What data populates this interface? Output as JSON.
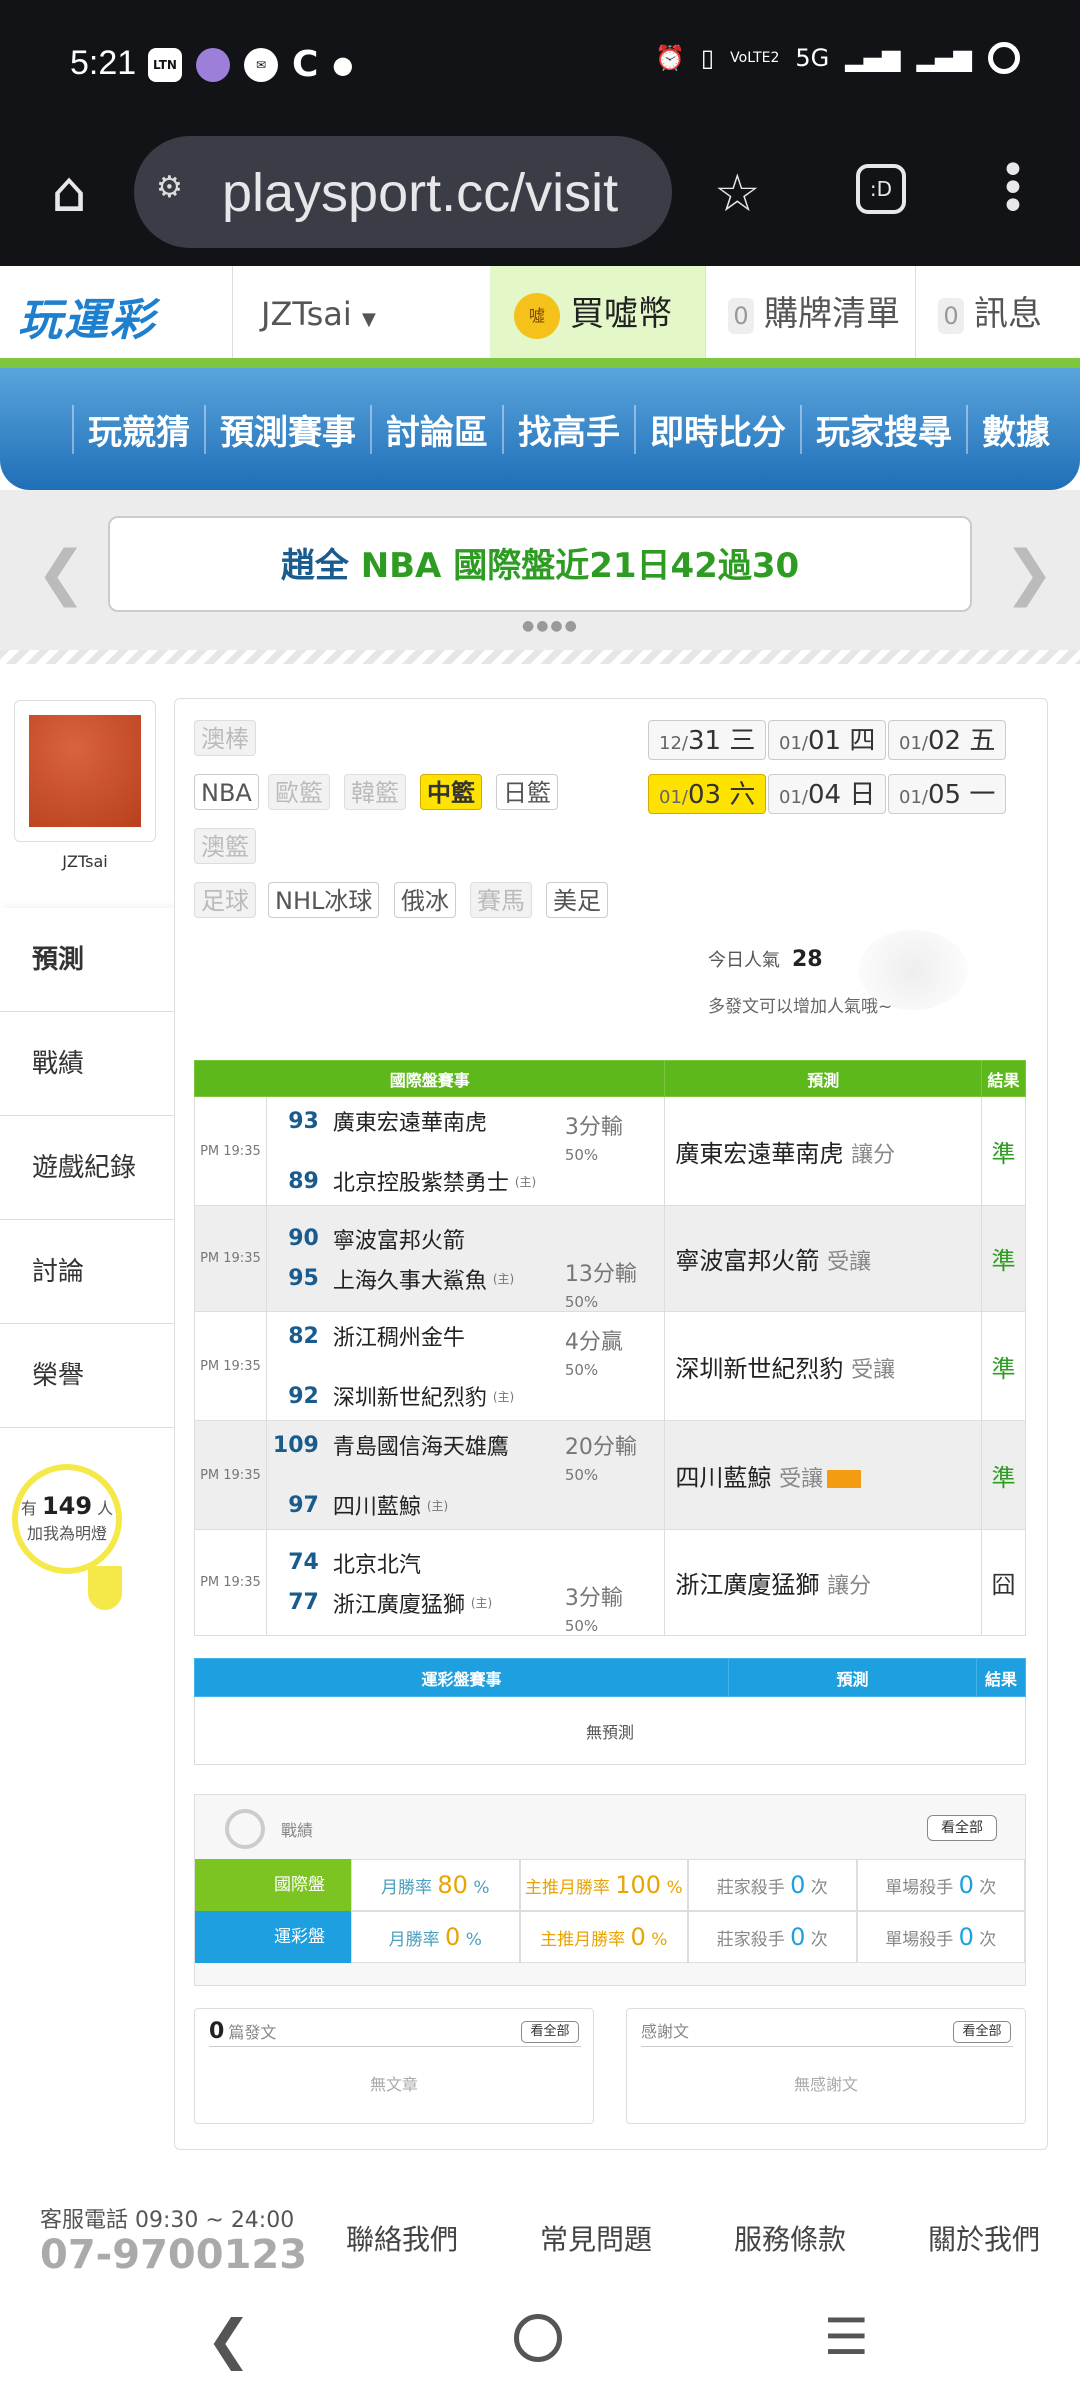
{
  "status": {
    "time": "5:21",
    "icons": [
      "LTN",
      "Twitter",
      "Messenger",
      "C"
    ],
    "network": "5G"
  },
  "browser": {
    "url": "playsport.cc/visit"
  },
  "header": {
    "logo": "玩運彩",
    "username": "JZTsai",
    "coin": "買噓幣",
    "cart_count": "0",
    "cart_label": "購牌清單",
    "msg_count": "0",
    "msg_label": "訊息"
  },
  "nav": [
    "玩競猜",
    "預測賽事",
    "討論區",
    "找高手",
    "即時比分",
    "玩家搜尋",
    "數據"
  ],
  "banner": {
    "part1": "趙全",
    "part2": "NBA 國際盤近21日42過30"
  },
  "user": {
    "name": "JZTsai"
  },
  "left_menu": [
    "預測",
    "戰績",
    "遊戲紀錄",
    "討論",
    "榮譽"
  ],
  "bulb": {
    "prefix": "有",
    "count": "149",
    "suffix": "人",
    "line2": "加我為明燈"
  },
  "sports": {
    "row1": [
      "澳棒"
    ],
    "row2": [
      "NBA",
      "歐籃",
      "韓籃",
      "中籃",
      "日籃"
    ],
    "row3": [
      "澳籃"
    ],
    "row4": [
      "足球",
      "NHL冰球",
      "俄冰",
      "賽馬",
      "美足"
    ]
  },
  "dates": [
    {
      "md": "12/",
      "d": "31",
      "w": "三"
    },
    {
      "md": "01/",
      "d": "01",
      "w": "四"
    },
    {
      "md": "01/",
      "d": "02",
      "w": "五"
    },
    {
      "md": "01/",
      "d": "03",
      "w": "六"
    },
    {
      "md": "01/",
      "d": "04",
      "w": "日"
    },
    {
      "md": "01/",
      "d": "05",
      "w": "一"
    }
  ],
  "popularity": {
    "label": "今日人氣",
    "value": "28",
    "hint": "多發文可以增加人氣哦~"
  },
  "intl_table": {
    "headers": [
      "國際盤賽事",
      "預測",
      "結果"
    ],
    "rows": [
      {
        "time": "PM 19:35",
        "s1": "93",
        "t1": "廣東宏遠華南虎",
        "s2": "89",
        "t2": "北京控股紫禁勇士",
        "home": "(主)",
        "hcp": "3分輸",
        "pct": "50%",
        "pred": "廣東宏遠華南虎",
        "pred_sub": "讓分",
        "res": "準"
      },
      {
        "time": "PM 19:35",
        "s1": "90",
        "t1": "寧波富邦火箭",
        "s2": "95",
        "t2": "上海久事大鯊魚",
        "home": "(主)",
        "hcp": "13分輸",
        "pct": "50%",
        "pred": "寧波富邦火箭",
        "pred_sub": "受讓",
        "res": "準"
      },
      {
        "time": "PM 19:35",
        "s1": "82",
        "t1": "浙江稠州金牛",
        "s2": "92",
        "t2": "深圳新世紀烈豹",
        "home": "(主)",
        "hcp": "4分贏",
        "pct": "50%",
        "pred": "深圳新世紀烈豹",
        "pred_sub": "受讓",
        "res": "準"
      },
      {
        "time": "PM 19:35",
        "s1": "109",
        "t1": "青島國信海天雄鷹",
        "s2": "97",
        "t2": "四川藍鯨",
        "home": "(主)",
        "hcp": "20分輸",
        "pct": "50%",
        "pred": "四川藍鯨",
        "pred_sub": "受讓",
        "res": "準"
      },
      {
        "time": "PM 19:35",
        "s1": "74",
        "t1": "北京北汽",
        "s2": "77",
        "t2": "浙江廣廈猛獅",
        "home": "(主)",
        "hcp": "3分輸",
        "pct": "50%",
        "pred": "浙江廣廈猛獅",
        "pred_sub": "讓分",
        "res": "囧"
      }
    ]
  },
  "lottery_table": {
    "headers": [
      "運彩盤賽事",
      "預測",
      "結果"
    ],
    "empty": "無預測"
  },
  "stats": {
    "title": "戰績",
    "view_all": "看全部",
    "rows": [
      {
        "label": "國際盤",
        "color": "#7cc422",
        "c1l": "月勝率",
        "c1v": "80",
        "c2l": "主推月勝率",
        "c2v": "100",
        "c3l": "莊家殺手",
        "c3v": "0",
        "c4l": "單場殺手",
        "c4v": "0"
      },
      {
        "label": "運彩盤",
        "color": "#1ea0e0",
        "c1l": "月勝率",
        "c1v": "0",
        "c2l": "主推月勝率",
        "c2v": "0",
        "c3l": "莊家殺手",
        "c3v": "0",
        "c4l": "單場殺手",
        "c4v": "0"
      }
    ],
    "pct": "%",
    "times": "次"
  },
  "posts": {
    "count": "0",
    "label": "篇發文",
    "view_all": "看全部",
    "empty": "無文章"
  },
  "thanks": {
    "label": "感謝文",
    "view_all": "看全部",
    "empty": "無感謝文"
  },
  "footer": {
    "phone_label": "客服電話 09:30 ~ 24:00",
    "phone": "07-9700123",
    "links": [
      "聯絡我們",
      "常見問題",
      "服務條款",
      "關於我們"
    ]
  }
}
